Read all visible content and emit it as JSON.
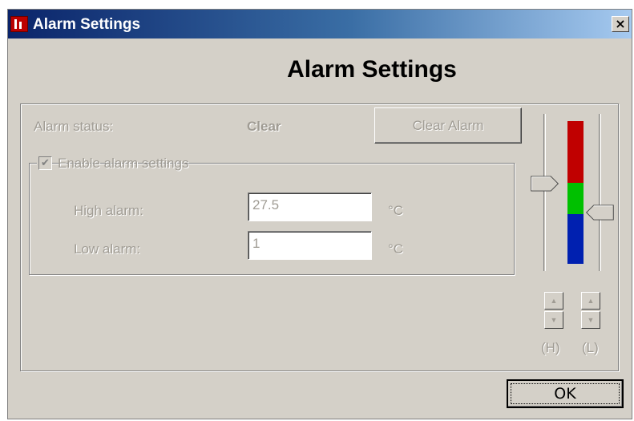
{
  "window": {
    "title": "Alarm Settings",
    "close_glyph": "×"
  },
  "heading": "Alarm Settings",
  "status": {
    "label": "Alarm status:",
    "value": "Clear",
    "clear_button": "Clear Alarm"
  },
  "group": {
    "enabled_label": "Enable alarm settings",
    "checked": true,
    "check_glyph": "✔"
  },
  "high": {
    "label": "High alarm:",
    "value": "27.5",
    "unit": "°C"
  },
  "low": {
    "label": "Low alarm:",
    "value": "1",
    "unit": "°C"
  },
  "indicator": {
    "colors": [
      "#c00000",
      "#00c000",
      "#0020b0"
    ],
    "track_color": "#d4d0c8"
  },
  "spinners": {
    "high_label": "(H)",
    "low_label": "(L)",
    "up_glyph": "▲",
    "down_glyph": "▼"
  },
  "ok_button": "OK"
}
